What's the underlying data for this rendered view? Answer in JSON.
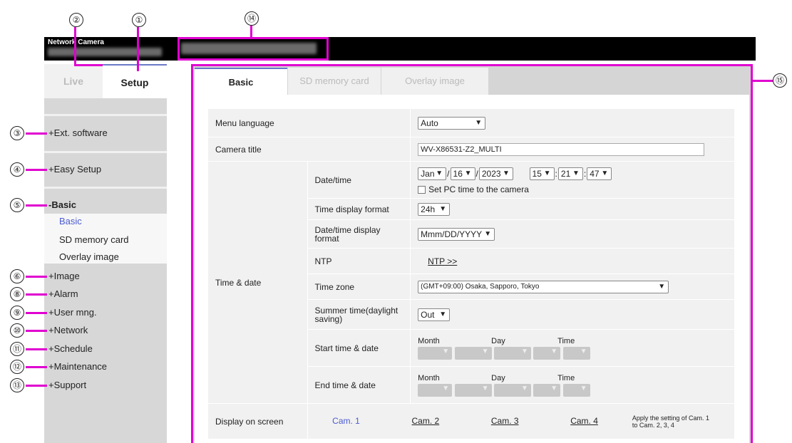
{
  "callouts": [
    "①",
    "②",
    "③",
    "④",
    "⑤",
    "⑥",
    "⑧",
    "⑨",
    "⑩",
    "⑪",
    "⑫",
    "⑬",
    "⑭",
    "⑮"
  ],
  "header": {
    "brand": "Network Camera"
  },
  "tabs": {
    "live": "Live",
    "setup": "Setup"
  },
  "sidebar": {
    "items": [
      "+Ext. software",
      "+Easy Setup",
      "-Basic",
      "+Image",
      "+Alarm",
      "+User mng.",
      "+Network",
      "+Schedule",
      "+Maintenance",
      "+Support"
    ],
    "basic_sub": [
      "Basic",
      "SD memory card",
      "Overlay image"
    ]
  },
  "content_tabs": [
    "Basic",
    "SD memory card",
    "Overlay image"
  ],
  "settings": {
    "menu_language_label": "Menu language",
    "menu_language_value": "Auto",
    "camera_title_label": "Camera title",
    "camera_title_value": "WV-X86531-Z2_MULTI",
    "time_date_label": "Time & date",
    "datetime_label": "Date/time",
    "month_value": "Jan",
    "day_value": "16",
    "year_value": "2023",
    "hour_value": "15",
    "minute_value": "21",
    "second_value": "47",
    "set_pc_time": "Set PC time to the camera",
    "time_format_label": "Time display format",
    "time_format_value": "24h",
    "datetime_format_label": "Date/time display format",
    "datetime_format_value": "Mmm/DD/YYYY",
    "ntp_label": "NTP",
    "ntp_link": "NTP >>",
    "timezone_label": "Time zone",
    "timezone_value": "(GMT+09:00) Osaka, Sapporo, Tokyo",
    "summer_label": "Summer time(daylight saving)",
    "summer_value": "Out",
    "start_label": "Start time & date",
    "end_label": "End time & date",
    "month_hdr": "Month",
    "day_hdr": "Day",
    "time_hdr": "Time",
    "display_label": "Display on screen",
    "cams": [
      "Cam. 1",
      "Cam. 2",
      "Cam. 3",
      "Cam. 4"
    ],
    "apply_note": "Apply the setting of Cam. 1 to Cam. 2, 3, 4"
  },
  "colors": {
    "highlight": "#e000d0",
    "active_link": "#4b5bd0",
    "accent": "#6b79c8"
  }
}
